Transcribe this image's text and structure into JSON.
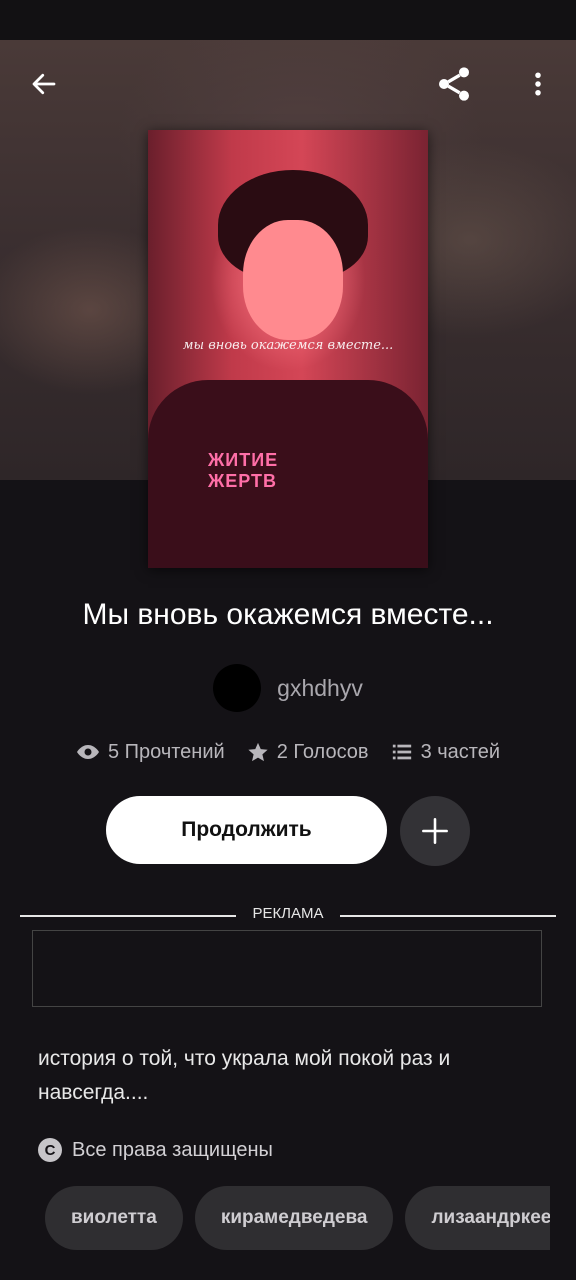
{
  "story": {
    "title": "Мы вновь окажемся вместе...",
    "cover_text": "мы вновь окажемся вместе...",
    "cover_print": "ЖИТИЕ ЖЕРТВ",
    "author": "gxhdhyv",
    "stats": {
      "reads": "5 Прочтений",
      "votes": "2 Голосов",
      "parts": "3 частей"
    },
    "continue_label": "Продолжить",
    "description": "история о той, что украла мой покой раз и навсегда....",
    "rights": "Все права защищены"
  },
  "ad": {
    "label": "РЕКЛАМА"
  },
  "tags": [
    "виолетта",
    "кирамедведева",
    "лизаандркеев"
  ],
  "icons": {
    "back": "arrow-left-icon",
    "share": "share-icon",
    "more": "more-vertical-icon",
    "eye": "eye-icon",
    "star": "star-icon",
    "list": "list-icon",
    "plus": "plus-icon",
    "copyright": "copyright-icon"
  },
  "colors": {
    "background": "#141216",
    "button_bg": "#ffffff",
    "chip_bg": "#2f2e31"
  }
}
